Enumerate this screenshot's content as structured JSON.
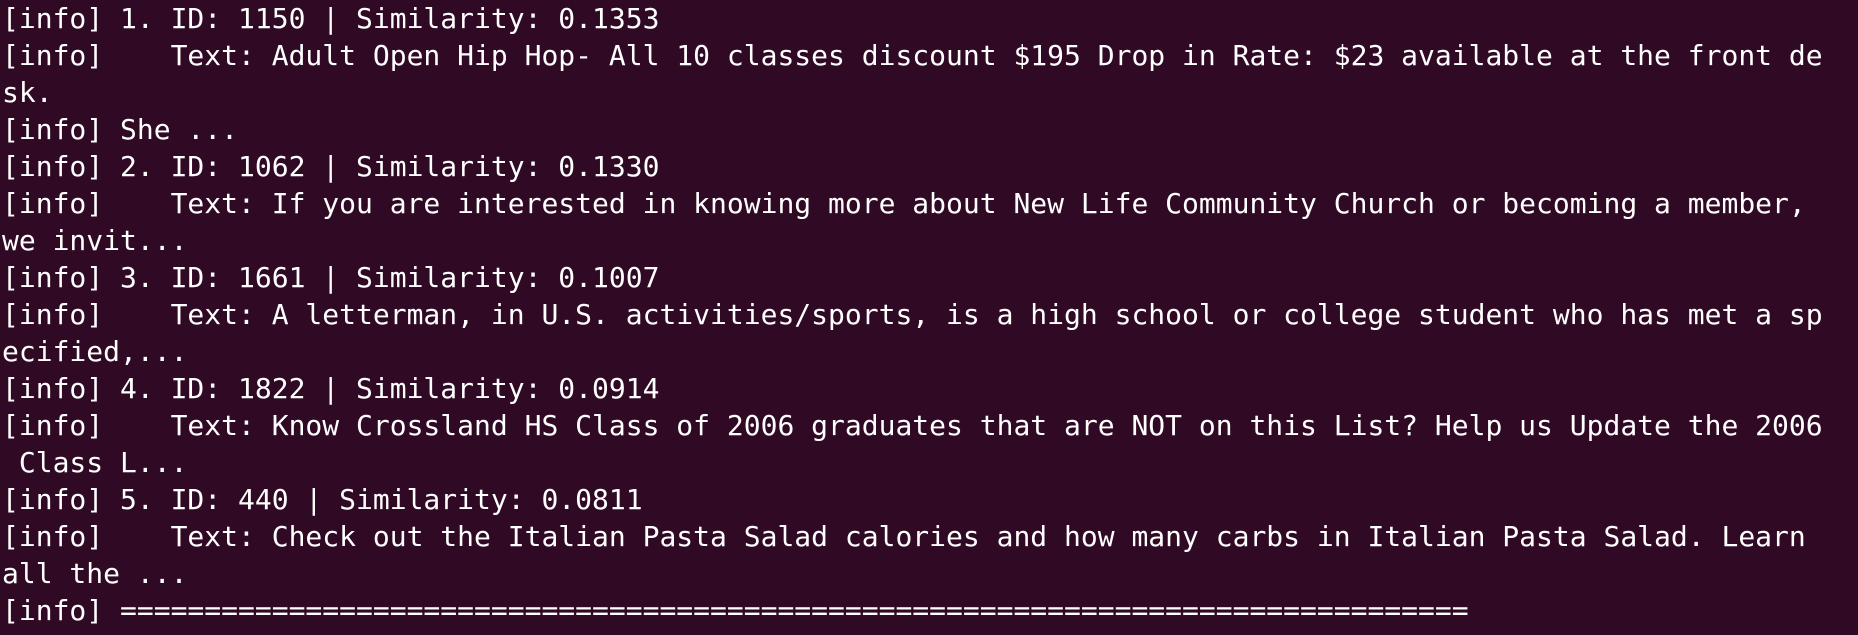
{
  "terminal": {
    "lines": [
      "[info] 1. ID: 1150 | Similarity: 0.1353",
      "[info]    Text: Adult Open Hip Hop- All 10 classes discount $195 Drop in Rate: $23 available at the front de",
      "sk.",
      "[info] She ...",
      "[info] 2. ID: 1062 | Similarity: 0.1330",
      "[info]    Text: If you are interested in knowing more about New Life Community Church or becoming a member,",
      "we invit...",
      "[info] 3. ID: 1661 | Similarity: 0.1007",
      "[info]    Text: A letterman, in U.S. activities/sports, is a high school or college student who has met a sp",
      "ecified,...",
      "[info] 4. ID: 1822 | Similarity: 0.0914",
      "[info]    Text: Know Crossland HS Class of 2006 graduates that are NOT on this List? Help us Update the 2006",
      " Class L...",
      "[info] 5. ID: 440 | Similarity: 0.0811",
      "[info]    Text: Check out the Italian Pasta Salad calories and how many carbs in Italian Pasta Salad. Learn",
      "all the ...",
      "[info] ================================================================================"
    ]
  },
  "colors": {
    "background": "#300a24",
    "foreground": "#ffffff"
  }
}
